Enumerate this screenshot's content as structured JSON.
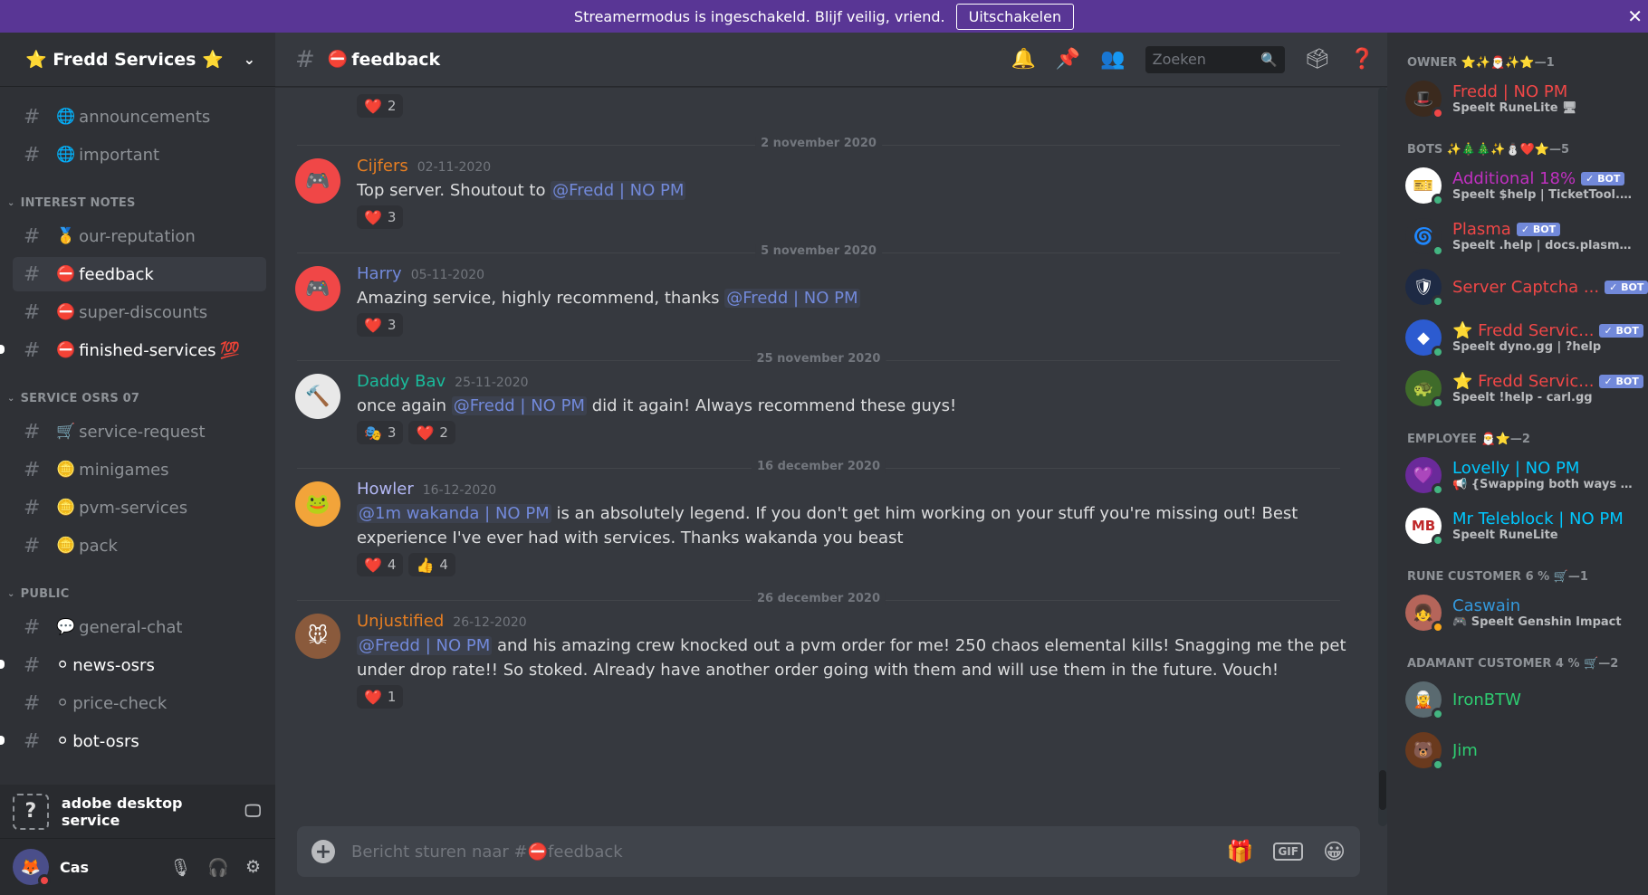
{
  "banner": {
    "text": "Streamermodus is ingeschakeld. Blijf veilig, vriend.",
    "button": "Uitschakelen"
  },
  "guild": {
    "name": "⭐ Fredd Services ⭐"
  },
  "channels": {
    "top": [
      {
        "label": "announcements",
        "emoji": "🌐"
      },
      {
        "label": "important",
        "emoji": "🌐"
      }
    ],
    "cat1": "INTEREST NOTES",
    "cat1_items": [
      {
        "label": "our-reputation",
        "emoji": "🥇"
      },
      {
        "label": "feedback",
        "emoji": "⛔"
      },
      {
        "label": "super-discounts",
        "emoji": "⛔"
      },
      {
        "label": "finished-services",
        "emoji": "⛔",
        "suffix": "💯"
      }
    ],
    "cat2": "SERVICE OSRS 07",
    "cat2_items": [
      {
        "label": "service-request",
        "emoji": "🛒"
      },
      {
        "label": "minigames",
        "emoji": "🪙"
      },
      {
        "label": "pvm-services",
        "emoji": "🪙"
      },
      {
        "label": "pack",
        "emoji": "🪙"
      }
    ],
    "cat3": "PUBLIC",
    "cat3_items": [
      {
        "label": "general-chat",
        "emoji": "💬"
      },
      {
        "label": "news-osrs",
        "emoji": "⚪"
      },
      {
        "label": "price-check",
        "emoji": "⚪"
      },
      {
        "label": "bot-osrs",
        "emoji": "⚪"
      }
    ]
  },
  "voice": {
    "label": "adobe desktop service"
  },
  "user": {
    "name": "Cas"
  },
  "channel": {
    "name": "feedback",
    "emoji": "⛔"
  },
  "search": {
    "placeholder": "Zoeken"
  },
  "messages": [
    {
      "date": "2 november 2020",
      "author": "Cijfers",
      "color": "#e67e22",
      "ts": "02-11-2020",
      "pre": "Top server. Shoutout to ",
      "mention": "@Fredd | NO PM",
      "post": "",
      "reacts": [
        {
          "e": "❤️",
          "n": "3"
        }
      ]
    },
    {
      "date": "5 november 2020",
      "author": "Harry",
      "color": "#7289da",
      "ts": "05-11-2020",
      "pre": "Amazing service, highly recommend, thanks ",
      "mention": "@Fredd | NO PM",
      "post": "",
      "reacts": [
        {
          "e": "❤️",
          "n": "3"
        }
      ]
    },
    {
      "date": "25 november 2020",
      "author": "Daddy Bav",
      "color": "#1abc9c",
      "ts": "25-11-2020",
      "pre": "once again ",
      "mention": "@Fredd | NO PM",
      "post": " did it again! Always recommend these guys!",
      "reacts": [
        {
          "e": "🎭",
          "n": "3"
        },
        {
          "e": "❤️",
          "n": "2"
        }
      ]
    },
    {
      "date": "16 december 2020",
      "author": "Howler",
      "color": "#b3b8f5",
      "ts": "16-12-2020",
      "pre": "",
      "mention": "@1m wakanda | NO PM",
      "post": " is an absolutely legend. If you don't get him working on your stuff you're missing out! Best experience I've ever had with services. Thanks wakanda you beast",
      "reacts": [
        {
          "e": "❤️",
          "n": "4"
        },
        {
          "e": "👍",
          "n": "4"
        }
      ]
    },
    {
      "date": "26 december 2020",
      "author": "Unjustified",
      "color": "#e67e22",
      "ts": "26-12-2020",
      "pre": "",
      "mention": "@Fredd | NO PM",
      "post": " and his amazing crew knocked out a pvm order for me! 250 chaos elemental kills! Snagging me the pet under drop rate!! So stoked. Already have another order going with them and will use them in the future. Vouch!",
      "reacts": [
        {
          "e": "❤️",
          "n": "1"
        }
      ]
    }
  ],
  "top_react": {
    "e": "❤️",
    "n": "2"
  },
  "composer": {
    "placeholder": "Bericht sturen naar #⛔feedback"
  },
  "members": [
    {
      "cat": "OWNER ⭐✨🎅✨⭐—1",
      "items": [
        {
          "name": "Fredd | NO PM",
          "color": "#f04747",
          "sub": "Speelt RuneLite 🖥",
          "status": "#f04747",
          "bot": false,
          "av": "🎩",
          "avbg": "#3b2a1e"
        }
      ]
    },
    {
      "cat": "BOTS ✨🎄🎄✨⛄❤️⭐—5",
      "items": [
        {
          "name": "Additional 18%",
          "color": "#c030c0",
          "sub": "Speelt $help | TicketTool.xyz | ...",
          "status": "#43b581",
          "bot": true,
          "av": "🎫",
          "avbg": "#ffffff"
        },
        {
          "name": "Plasma",
          "color": "#f04747",
          "sub": "Speelt .help | docs.plasmabot....",
          "status": "#43b581",
          "bot": true,
          "av": "🌀",
          "avbg": "#2f3136"
        },
        {
          "name": "Server Captcha ...",
          "color": "#f04747",
          "sub": "",
          "status": "#43b581",
          "bot": true,
          "av": "🛡",
          "avbg": "#1e2a44"
        },
        {
          "name": "⭐ Fredd Servic...",
          "color": "#f04747",
          "sub": "Speelt dyno.gg | ?help",
          "status": "#43b581",
          "bot": true,
          "av": "◆",
          "avbg": "#2c5bd0"
        },
        {
          "name": "⭐ Fredd Servic...",
          "color": "#f04747",
          "sub": "Speelt !help - carl.gg",
          "status": "#43b581",
          "bot": true,
          "av": "🐢",
          "avbg": "#3f6b2a"
        }
      ]
    },
    {
      "cat": "EMPLOYEE 🎅⭐—2",
      "items": [
        {
          "name": "Lovelly | NO PM",
          "color": "#00c8ff",
          "sub": "📢 {Swapping both ways & Q...",
          "status": "#43b581",
          "bot": false,
          "av": "💜",
          "avbg": "#6a2a9a"
        },
        {
          "name": "Mr Teleblock | NO PM",
          "color": "#00c8ff",
          "sub": "Speelt RuneLite",
          "status": "#43b581",
          "bot": false,
          "av": "MB",
          "avbg": "#ffffff"
        }
      ]
    },
    {
      "cat": "RUNE CUSTOMER 6 % 🛒—1",
      "items": [
        {
          "name": "Caswain",
          "color": "#3498db",
          "sub": "🎮 Speelt Genshin Impact",
          "status": "#faa61a",
          "bot": false,
          "av": "👧",
          "avbg": "#b5655a"
        }
      ]
    },
    {
      "cat": "ADAMANT CUSTOMER 4 % 🛒—2",
      "items": [
        {
          "name": "IronBTW",
          "color": "#2ecc71",
          "sub": "",
          "status": "#43b581",
          "bot": false,
          "av": "🧝",
          "avbg": "#5a6a70"
        },
        {
          "name": "Jim",
          "color": "#2ecc71",
          "sub": "",
          "status": "#43b581",
          "bot": false,
          "av": "🐻",
          "avbg": "#6a3a1e"
        }
      ]
    }
  ]
}
